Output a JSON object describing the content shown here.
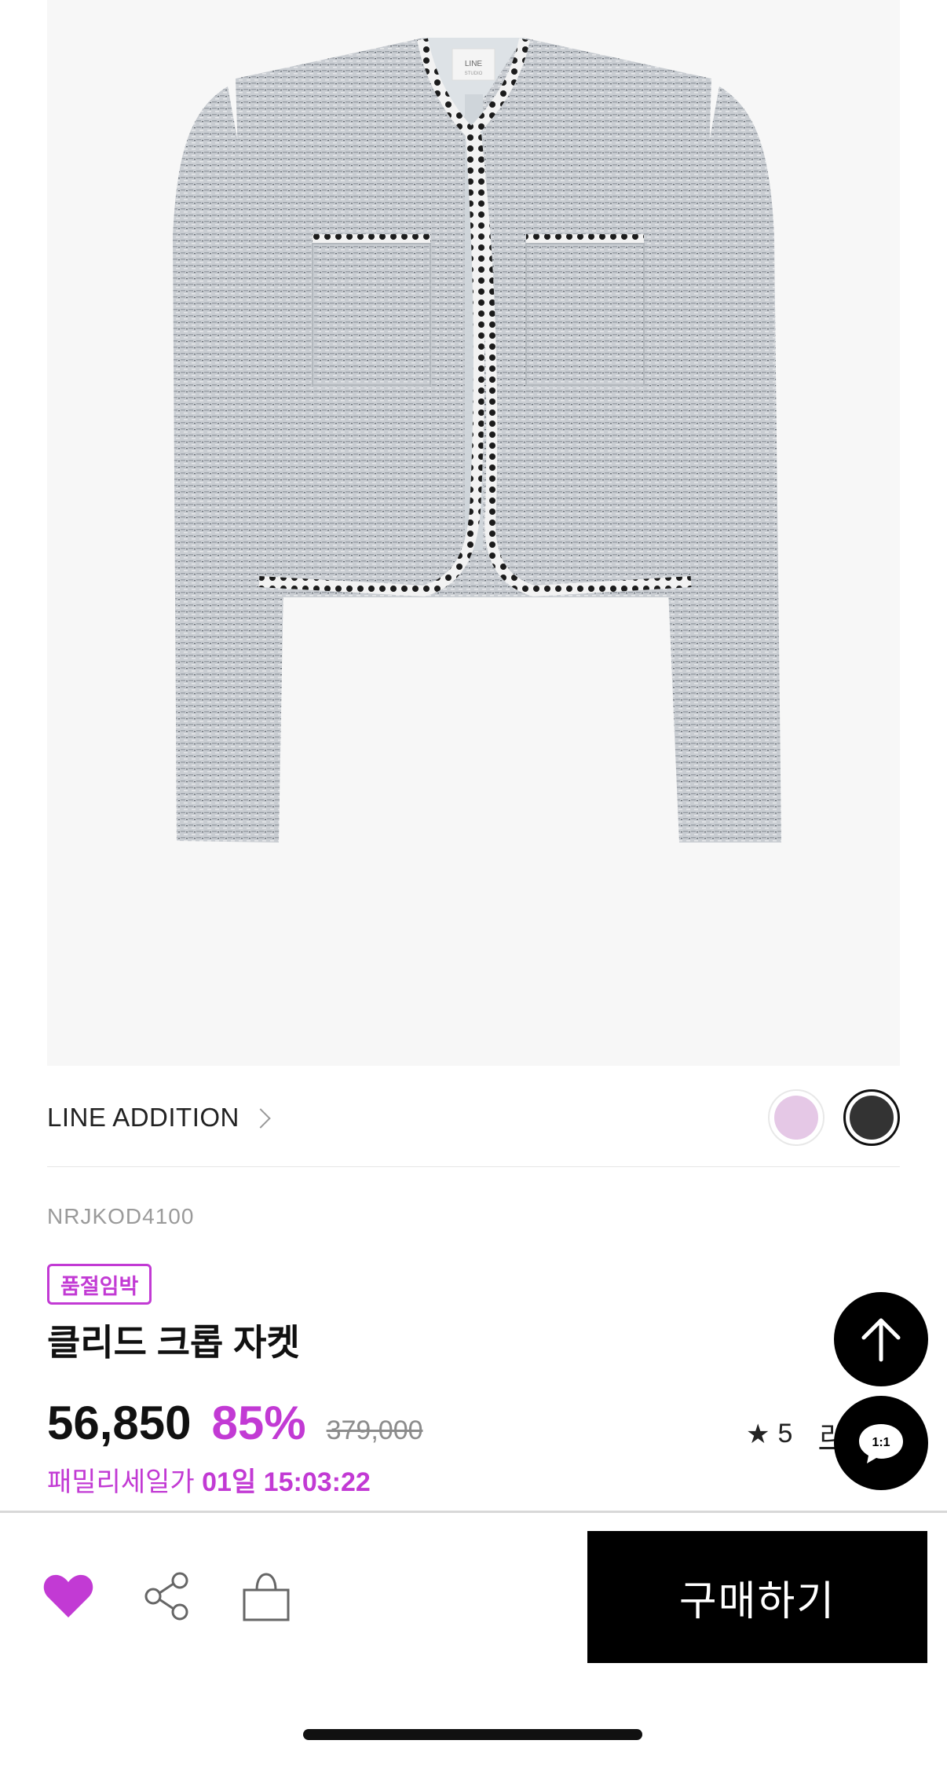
{
  "product": {
    "brand": "LINE ADDITION",
    "code": "NRJKOD4100",
    "badge": "품절임박",
    "name": "클리드 크롭 자켓",
    "price": "56,850",
    "discount": "85%",
    "original_price": "379,000",
    "sale_label": "패밀리세일가",
    "countdown": "01일 15:03:22",
    "rating_star": "★",
    "rating_value": "5",
    "review_label": "리뷰",
    "jacket_label_top": "LINE",
    "jacket_label_bottom": "STUDIO"
  },
  "swatches": [
    {
      "name": "pink",
      "color": "#e5c8e6"
    },
    {
      "name": "dark",
      "color": "#333333"
    }
  ],
  "fab": {
    "chat_label": "1:1"
  },
  "bottom_bar": {
    "buy_label": "구매하기"
  },
  "colors": {
    "accent": "#c23ad4",
    "black": "#000000",
    "image_bg": "#f7f7f7"
  }
}
